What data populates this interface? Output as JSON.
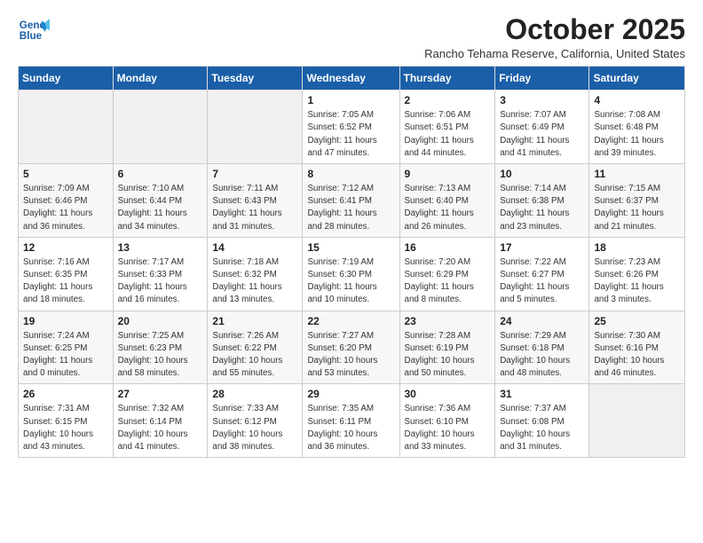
{
  "logo": {
    "line1": "General",
    "line2": "Blue"
  },
  "title": "October 2025",
  "subtitle": "Rancho Tehama Reserve, California, United States",
  "days_of_week": [
    "Sunday",
    "Monday",
    "Tuesday",
    "Wednesday",
    "Thursday",
    "Friday",
    "Saturday"
  ],
  "weeks": [
    [
      {
        "day": "",
        "info": ""
      },
      {
        "day": "",
        "info": ""
      },
      {
        "day": "",
        "info": ""
      },
      {
        "day": "1",
        "info": "Sunrise: 7:05 AM\nSunset: 6:52 PM\nDaylight: 11 hours\nand 47 minutes."
      },
      {
        "day": "2",
        "info": "Sunrise: 7:06 AM\nSunset: 6:51 PM\nDaylight: 11 hours\nand 44 minutes."
      },
      {
        "day": "3",
        "info": "Sunrise: 7:07 AM\nSunset: 6:49 PM\nDaylight: 11 hours\nand 41 minutes."
      },
      {
        "day": "4",
        "info": "Sunrise: 7:08 AM\nSunset: 6:48 PM\nDaylight: 11 hours\nand 39 minutes."
      }
    ],
    [
      {
        "day": "5",
        "info": "Sunrise: 7:09 AM\nSunset: 6:46 PM\nDaylight: 11 hours\nand 36 minutes."
      },
      {
        "day": "6",
        "info": "Sunrise: 7:10 AM\nSunset: 6:44 PM\nDaylight: 11 hours\nand 34 minutes."
      },
      {
        "day": "7",
        "info": "Sunrise: 7:11 AM\nSunset: 6:43 PM\nDaylight: 11 hours\nand 31 minutes."
      },
      {
        "day": "8",
        "info": "Sunrise: 7:12 AM\nSunset: 6:41 PM\nDaylight: 11 hours\nand 28 minutes."
      },
      {
        "day": "9",
        "info": "Sunrise: 7:13 AM\nSunset: 6:40 PM\nDaylight: 11 hours\nand 26 minutes."
      },
      {
        "day": "10",
        "info": "Sunrise: 7:14 AM\nSunset: 6:38 PM\nDaylight: 11 hours\nand 23 minutes."
      },
      {
        "day": "11",
        "info": "Sunrise: 7:15 AM\nSunset: 6:37 PM\nDaylight: 11 hours\nand 21 minutes."
      }
    ],
    [
      {
        "day": "12",
        "info": "Sunrise: 7:16 AM\nSunset: 6:35 PM\nDaylight: 11 hours\nand 18 minutes."
      },
      {
        "day": "13",
        "info": "Sunrise: 7:17 AM\nSunset: 6:33 PM\nDaylight: 11 hours\nand 16 minutes."
      },
      {
        "day": "14",
        "info": "Sunrise: 7:18 AM\nSunset: 6:32 PM\nDaylight: 11 hours\nand 13 minutes."
      },
      {
        "day": "15",
        "info": "Sunrise: 7:19 AM\nSunset: 6:30 PM\nDaylight: 11 hours\nand 10 minutes."
      },
      {
        "day": "16",
        "info": "Sunrise: 7:20 AM\nSunset: 6:29 PM\nDaylight: 11 hours\nand 8 minutes."
      },
      {
        "day": "17",
        "info": "Sunrise: 7:22 AM\nSunset: 6:27 PM\nDaylight: 11 hours\nand 5 minutes."
      },
      {
        "day": "18",
        "info": "Sunrise: 7:23 AM\nSunset: 6:26 PM\nDaylight: 11 hours\nand 3 minutes."
      }
    ],
    [
      {
        "day": "19",
        "info": "Sunrise: 7:24 AM\nSunset: 6:25 PM\nDaylight: 11 hours\nand 0 minutes."
      },
      {
        "day": "20",
        "info": "Sunrise: 7:25 AM\nSunset: 6:23 PM\nDaylight: 10 hours\nand 58 minutes."
      },
      {
        "day": "21",
        "info": "Sunrise: 7:26 AM\nSunset: 6:22 PM\nDaylight: 10 hours\nand 55 minutes."
      },
      {
        "day": "22",
        "info": "Sunrise: 7:27 AM\nSunset: 6:20 PM\nDaylight: 10 hours\nand 53 minutes."
      },
      {
        "day": "23",
        "info": "Sunrise: 7:28 AM\nSunset: 6:19 PM\nDaylight: 10 hours\nand 50 minutes."
      },
      {
        "day": "24",
        "info": "Sunrise: 7:29 AM\nSunset: 6:18 PM\nDaylight: 10 hours\nand 48 minutes."
      },
      {
        "day": "25",
        "info": "Sunrise: 7:30 AM\nSunset: 6:16 PM\nDaylight: 10 hours\nand 46 minutes."
      }
    ],
    [
      {
        "day": "26",
        "info": "Sunrise: 7:31 AM\nSunset: 6:15 PM\nDaylight: 10 hours\nand 43 minutes."
      },
      {
        "day": "27",
        "info": "Sunrise: 7:32 AM\nSunset: 6:14 PM\nDaylight: 10 hours\nand 41 minutes."
      },
      {
        "day": "28",
        "info": "Sunrise: 7:33 AM\nSunset: 6:12 PM\nDaylight: 10 hours\nand 38 minutes."
      },
      {
        "day": "29",
        "info": "Sunrise: 7:35 AM\nSunset: 6:11 PM\nDaylight: 10 hours\nand 36 minutes."
      },
      {
        "day": "30",
        "info": "Sunrise: 7:36 AM\nSunset: 6:10 PM\nDaylight: 10 hours\nand 33 minutes."
      },
      {
        "day": "31",
        "info": "Sunrise: 7:37 AM\nSunset: 6:08 PM\nDaylight: 10 hours\nand 31 minutes."
      },
      {
        "day": "",
        "info": ""
      }
    ]
  ]
}
